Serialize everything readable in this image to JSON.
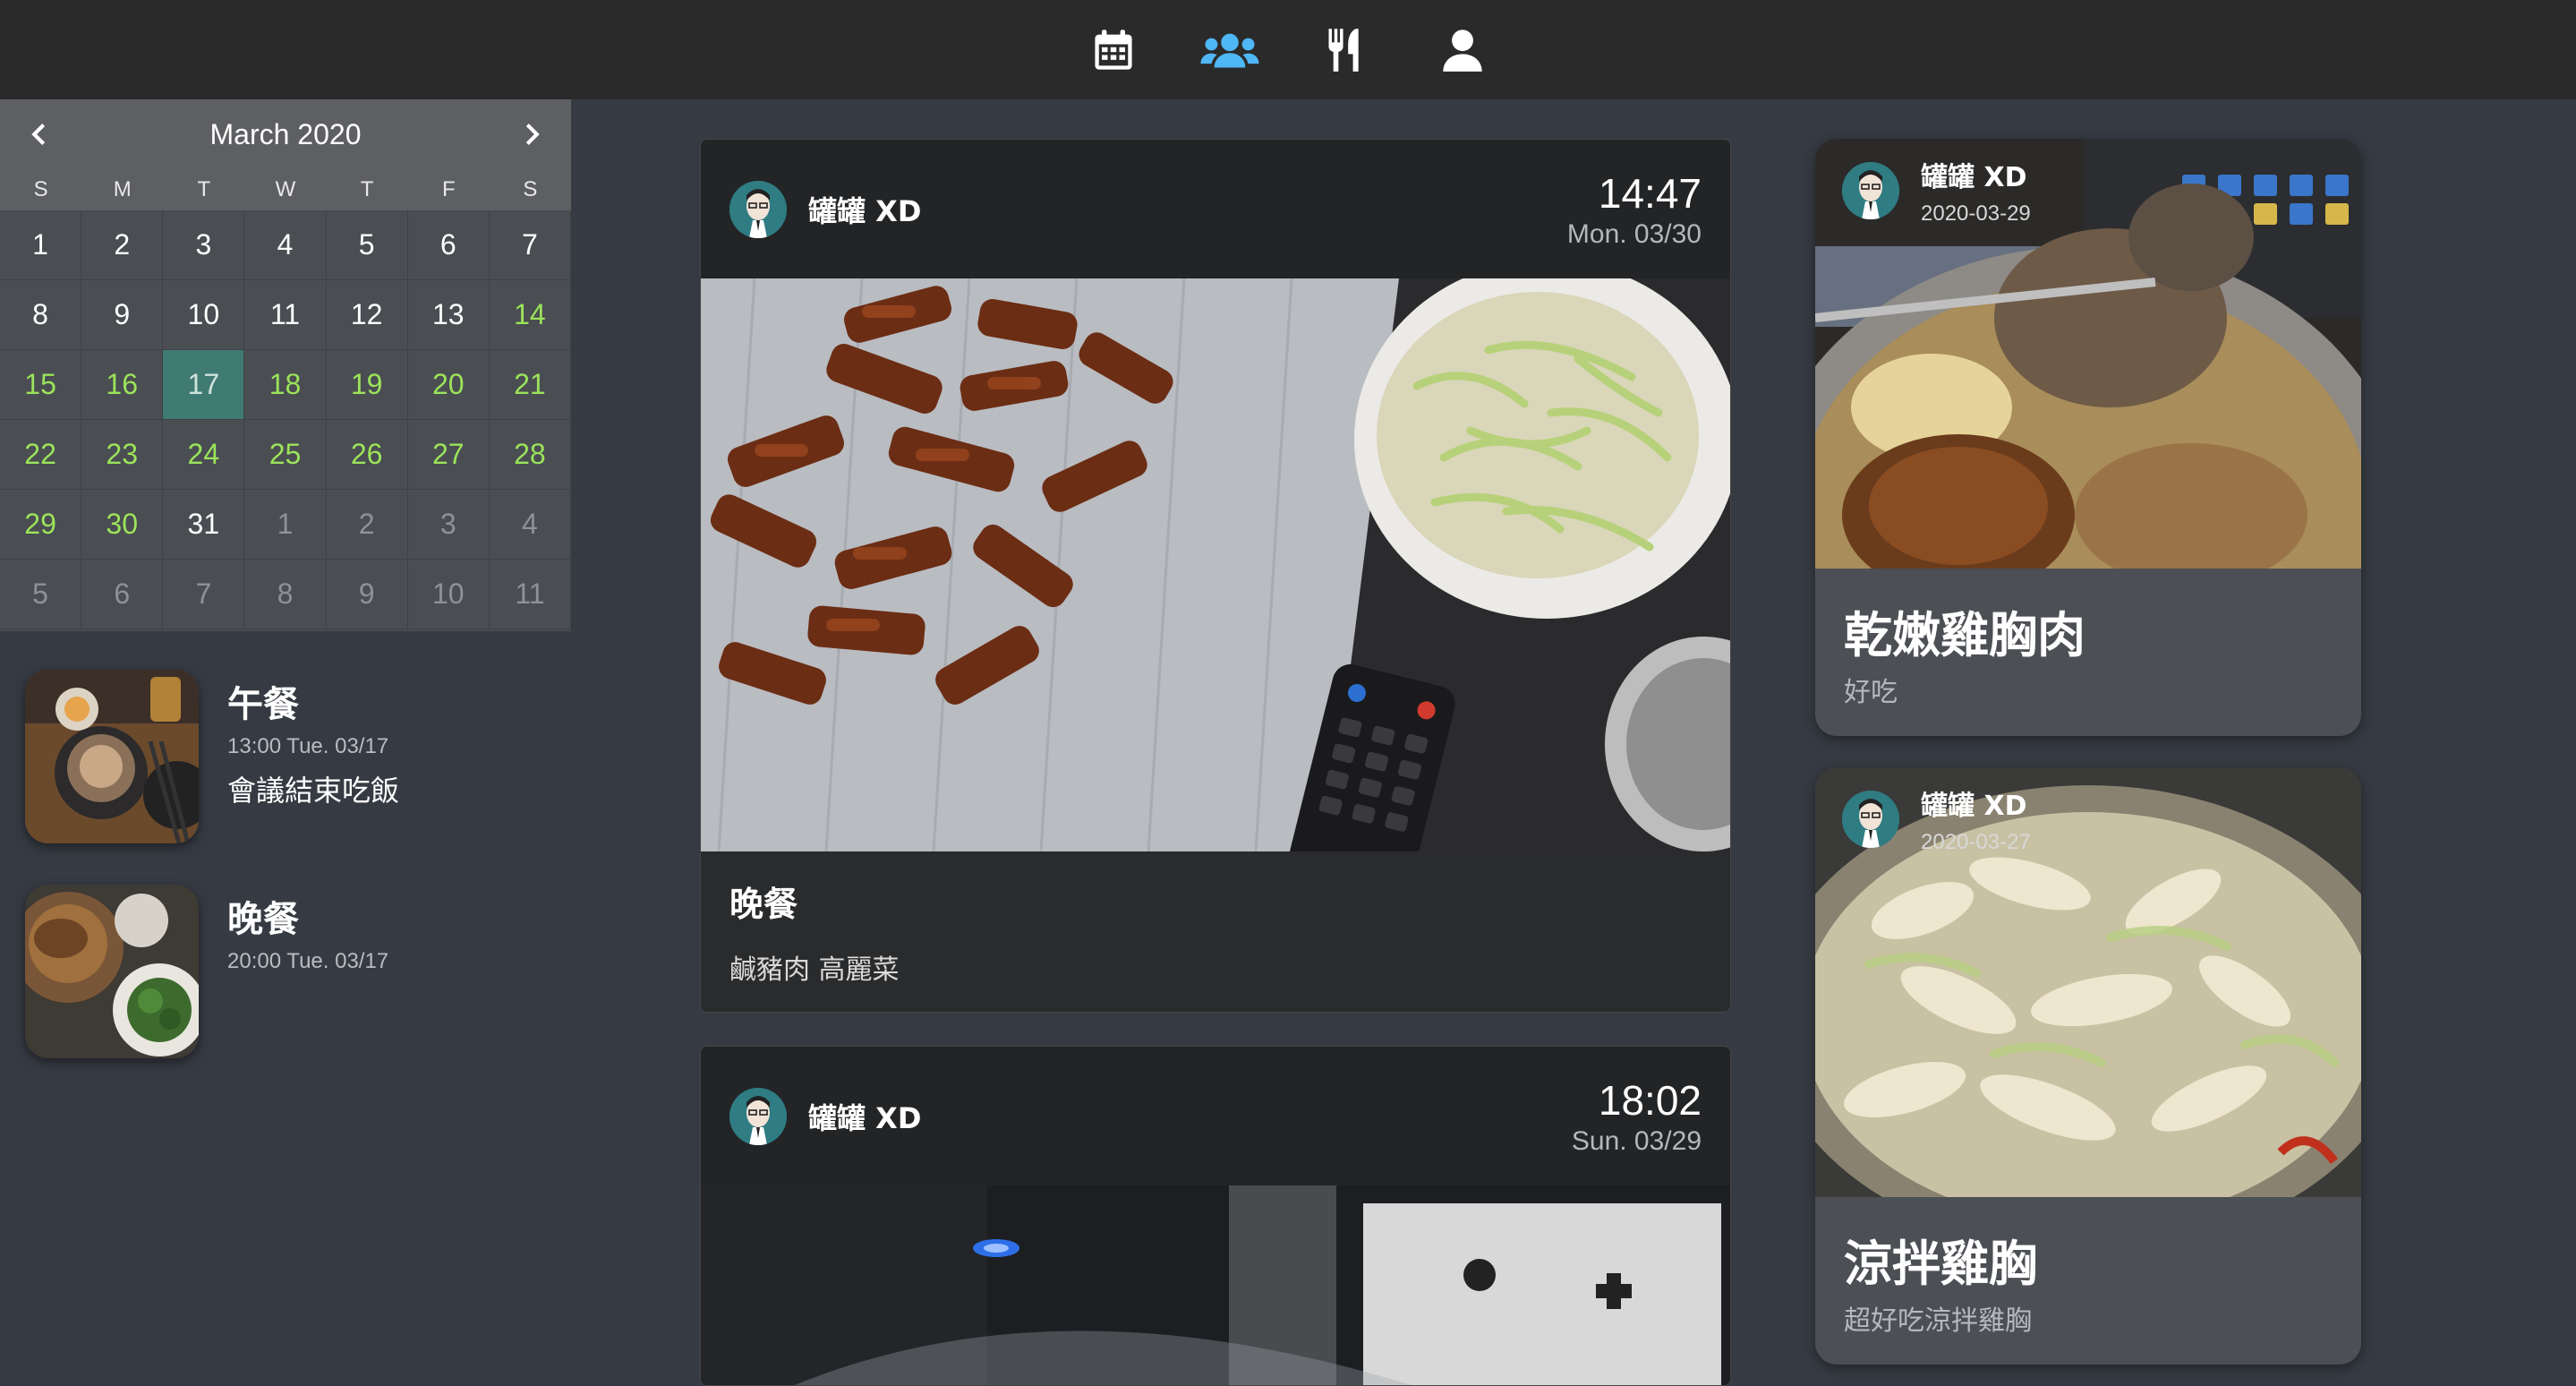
{
  "nav": {
    "items": [
      {
        "name": "calendar-icon",
        "color": "#ffffff"
      },
      {
        "name": "group-icon",
        "color": "#4fb7f5"
      },
      {
        "name": "utensils-icon",
        "color": "#ffffff"
      },
      {
        "name": "user-icon",
        "color": "#ffffff"
      }
    ]
  },
  "calendar": {
    "title": "March 2020",
    "weekdays": [
      "S",
      "M",
      "T",
      "W",
      "T",
      "F",
      "S"
    ],
    "weeks": [
      [
        {
          "d": "1",
          "c": "white"
        },
        {
          "d": "2",
          "c": "white"
        },
        {
          "d": "3",
          "c": "white"
        },
        {
          "d": "4",
          "c": "white"
        },
        {
          "d": "5",
          "c": "white"
        },
        {
          "d": "6",
          "c": "white"
        },
        {
          "d": "7",
          "c": "white"
        }
      ],
      [
        {
          "d": "8",
          "c": "white"
        },
        {
          "d": "9",
          "c": "white"
        },
        {
          "d": "10",
          "c": "white"
        },
        {
          "d": "11",
          "c": "white"
        },
        {
          "d": "12",
          "c": "white"
        },
        {
          "d": "13",
          "c": "white"
        },
        {
          "d": "14",
          "c": "green"
        }
      ],
      [
        {
          "d": "15",
          "c": "green"
        },
        {
          "d": "16",
          "c": "green"
        },
        {
          "d": "17",
          "c": "selected"
        },
        {
          "d": "18",
          "c": "green"
        },
        {
          "d": "19",
          "c": "green"
        },
        {
          "d": "20",
          "c": "green"
        },
        {
          "d": "21",
          "c": "green"
        }
      ],
      [
        {
          "d": "22",
          "c": "green"
        },
        {
          "d": "23",
          "c": "green"
        },
        {
          "d": "24",
          "c": "green"
        },
        {
          "d": "25",
          "c": "green"
        },
        {
          "d": "26",
          "c": "green"
        },
        {
          "d": "27",
          "c": "green"
        },
        {
          "d": "28",
          "c": "green"
        }
      ],
      [
        {
          "d": "29",
          "c": "green"
        },
        {
          "d": "30",
          "c": "green"
        },
        {
          "d": "31",
          "c": "white"
        },
        {
          "d": "1",
          "c": "grey"
        },
        {
          "d": "2",
          "c": "grey"
        },
        {
          "d": "3",
          "c": "grey"
        },
        {
          "d": "4",
          "c": "grey"
        }
      ],
      [
        {
          "d": "5",
          "c": "grey"
        },
        {
          "d": "6",
          "c": "grey"
        },
        {
          "d": "7",
          "c": "grey"
        },
        {
          "d": "8",
          "c": "grey"
        },
        {
          "d": "9",
          "c": "grey"
        },
        {
          "d": "10",
          "c": "grey"
        },
        {
          "d": "11",
          "c": "grey"
        }
      ]
    ]
  },
  "day_meals": [
    {
      "title": "午餐",
      "time": "13:00 Tue. 03/17",
      "desc": "會議結束吃飯"
    },
    {
      "title": "晚餐",
      "time": "20:00 Tue. 03/17",
      "desc": ""
    }
  ],
  "feed": [
    {
      "user": "罐罐 XD",
      "clock": "14:47",
      "date": "Mon. 03/30",
      "title": "晚餐",
      "desc": "鹹豬肉 高麗菜"
    },
    {
      "user": "罐罐 XD",
      "clock": "18:02",
      "date": "Sun. 03/29"
    }
  ],
  "cards": [
    {
      "user": "罐罐 XD",
      "date": "2020-03-29",
      "title": "乾嫩雞胸肉",
      "desc": "好吃"
    },
    {
      "user": "罐罐 XD",
      "date": "2020-03-27",
      "title": "涼拌雞胸",
      "desc": "超好吃涼拌雞胸"
    }
  ]
}
